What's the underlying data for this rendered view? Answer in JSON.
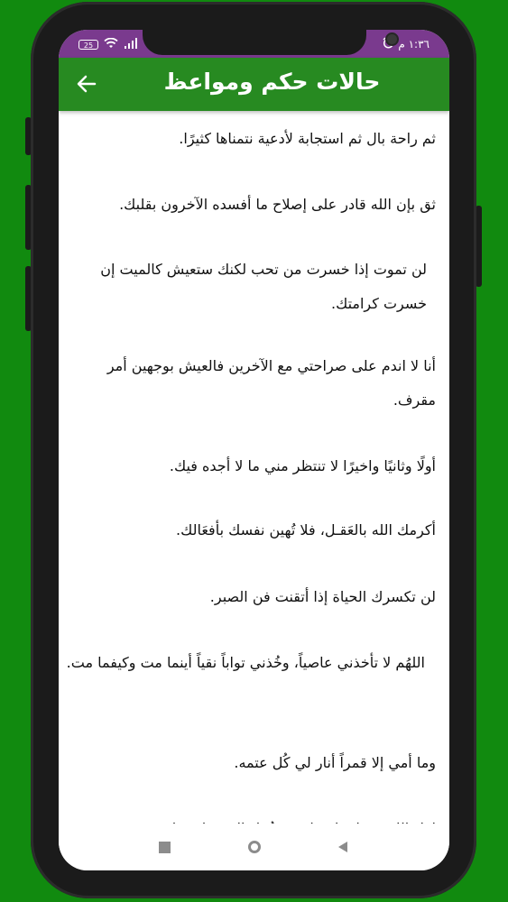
{
  "status_bar": {
    "battery": "25",
    "time": "١:٣٦ م"
  },
  "app_bar": {
    "title": "حالات حكم ومواعظ",
    "back_icon": "arrow-left-icon"
  },
  "phrases": [
    "ثم راحة بال ثم استجابة لأدعية نتمناها كثيرًا.",
    "ثق بإن الله قادر على إصلاح ما أفسده الآخرون بقلبك.",
    "لن تموت إذا خسرت من تحب لكنك ستعيش كالميت إن خسرت كرامتك.",
    "أنا لا اندم على صراحتي مع الآخرين فالعيش بوجهين أمر مقرف.",
    "أولًا وثانيًا واخيرًا لا تنتظر مني ما لا أجده فيك.",
    "أكرمك الله بالعَقـل، فلا تُهين نفسك بأفعَالك.",
    "لن تكسرك الحياة إذا أتقنت فن الصبر.",
    "اللهُم لا تأخذني عاصياً، وخُذني تواباً نقياً أينما مت وكيفما مت.",
    "وما أمي إلا قمراً أنار لي كُل عتمه.",
    "لعل الله في لحظة ما يغير عُمل الذي ظننته ان"
  ],
  "nav": {
    "recents_icon": "square-icon",
    "home_icon": "circle-icon",
    "back_icon": "triangle-back-icon"
  },
  "colors": {
    "background": "#118a0f",
    "status_bar": "#7a3a8e",
    "app_bar": "#278a21"
  }
}
